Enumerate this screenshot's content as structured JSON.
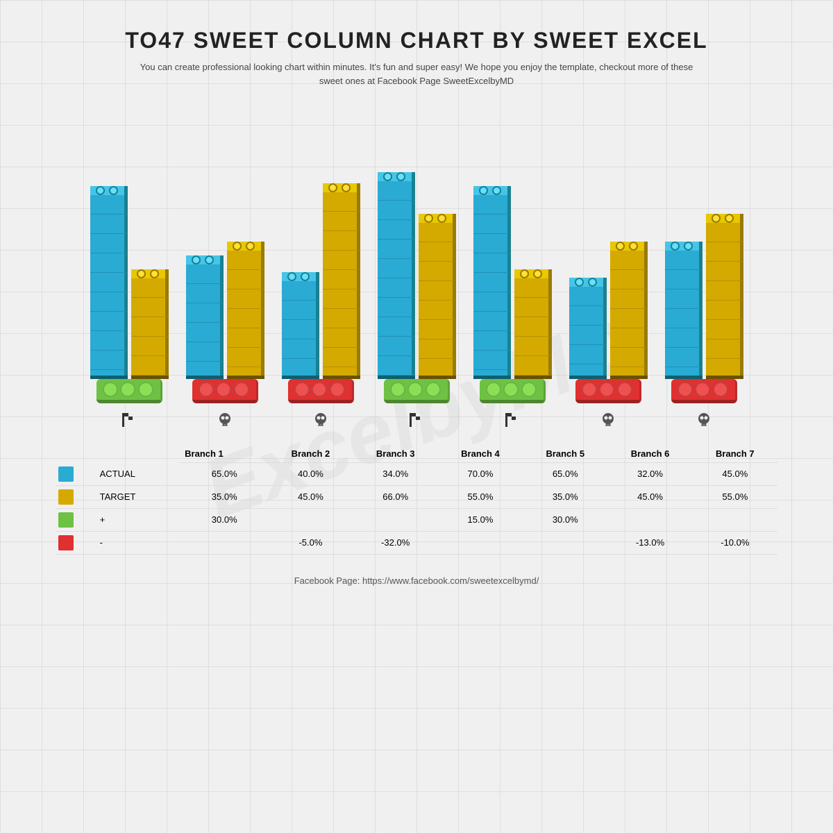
{
  "title": "TO47 SWEET COLUMN CHART BY SWEET EXCEL",
  "subtitle": "You can create professional looking chart within minutes. It's fun and super easy! We hope you enjoy the template, checkout more of these sweet ones at Facebook Page SweetExcelbyMD",
  "watermark": "ExcelbyMD",
  "legend": {
    "actual_label": "ACTUAL",
    "target_label": "TARGET",
    "plus_label": "+",
    "minus_label": "-",
    "actual_color": "#29ABD4",
    "target_color": "#D4AA00",
    "plus_color": "#6DC244",
    "minus_color": "#E03030"
  },
  "branches": [
    {
      "name": "Branch 1",
      "actual": 65,
      "target": 35,
      "plus": "30.0%",
      "minus": "",
      "badge_type": "green",
      "icon": "🏁"
    },
    {
      "name": "Branch 2",
      "actual": 40,
      "target": 45,
      "plus": "",
      "minus": "-5.0%",
      "badge_type": "red",
      "icon": "💀"
    },
    {
      "name": "Branch 3",
      "actual": 34,
      "target": 66,
      "plus": "",
      "minus": "-32.0%",
      "badge_type": "red",
      "icon": "💀"
    },
    {
      "name": "Branch 4",
      "actual": 70,
      "target": 55,
      "plus": "15.0%",
      "minus": "",
      "badge_type": "green",
      "icon": "🏁"
    },
    {
      "name": "Branch 5",
      "actual": 65,
      "target": 35,
      "plus": "30.0%",
      "minus": "",
      "badge_type": "green",
      "icon": "🏁"
    },
    {
      "name": "Branch 6",
      "actual": 32,
      "target": 45,
      "plus": "",
      "minus": "-13.0%",
      "badge_type": "red",
      "icon": "💀"
    },
    {
      "name": "Branch 7",
      "actual": 45,
      "target": 55,
      "plus": "",
      "minus": "-10.0%",
      "badge_type": "red",
      "icon": "💀"
    }
  ],
  "footer": "Facebook Page: https://www.facebook.com/sweetexcelbymd/"
}
